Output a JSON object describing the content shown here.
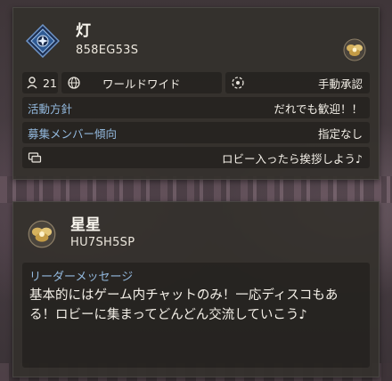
{
  "club": {
    "name": "灯",
    "id": "858EG53S",
    "members": "21",
    "region": "ワールドワイド",
    "approval": "手動承認",
    "policy_label": "活動方針",
    "policy_value": "だれでも歓迎！！",
    "recruit_label": "募集メンバー傾向",
    "recruit_value": "指定なし",
    "greeting": "ロビー入ったら挨拶しよう♪"
  },
  "leader": {
    "name": "星星",
    "id": "HU7SH5SP",
    "message_label": "リーダーメッセージ",
    "message": "基本的にはゲーム内チャットのみ！一応ディスコもある！ロビーに集まってどんどん交流していこう♪"
  },
  "colors": {
    "label_blue": "#93b9de",
    "panel_bg": "#34302c",
    "emblem_blue": "#2f5a93",
    "emblem_gold": "#d6b25e"
  },
  "icons": [
    "club-emblem-icon",
    "user-emblem-icon",
    "person-icon",
    "globe-icon",
    "approval-icon",
    "chat-icon"
  ]
}
